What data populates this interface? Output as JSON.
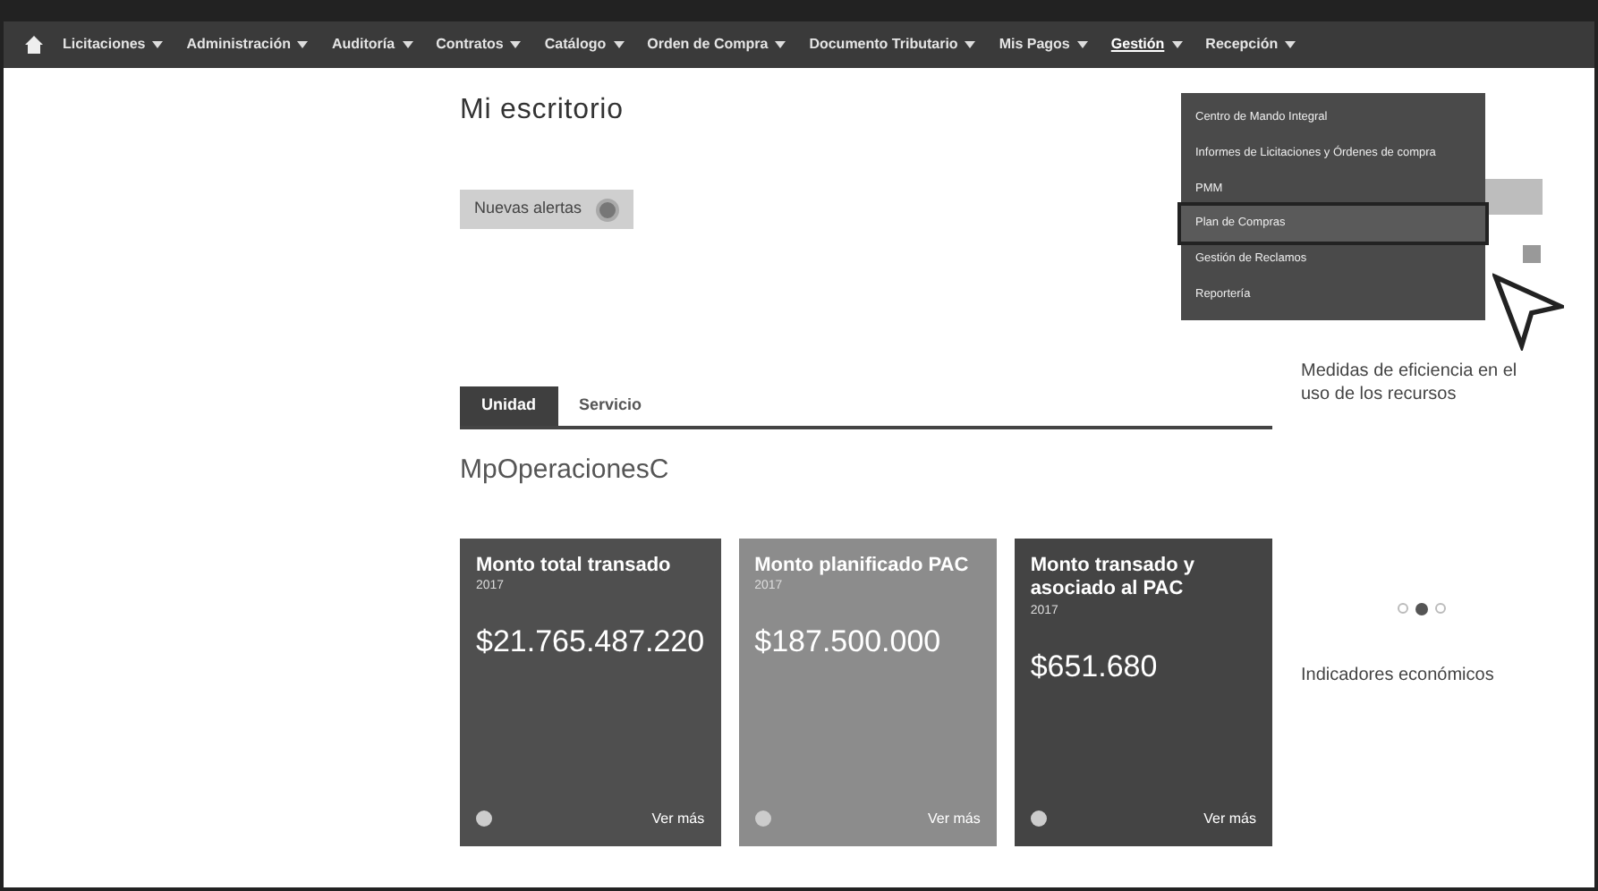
{
  "nav": {
    "items": [
      {
        "label": "Licitaciones",
        "open": false
      },
      {
        "label": "Administración",
        "open": false
      },
      {
        "label": "Auditoría",
        "open": false
      },
      {
        "label": "Contratos",
        "open": false
      },
      {
        "label": "Catálogo",
        "open": false
      },
      {
        "label": "Orden de Compra",
        "open": false
      },
      {
        "label": "Documento Tributario",
        "open": false
      },
      {
        "label": "Mis Pagos",
        "open": false
      },
      {
        "label": "Gestión",
        "open": true
      },
      {
        "label": "Recepción",
        "open": false
      }
    ]
  },
  "dropdown": {
    "items": [
      {
        "label": "Centro de Mando Integral",
        "selected": false
      },
      {
        "label": "Informes de Licitaciones y Órdenes de compra",
        "selected": false
      },
      {
        "label": "PMM",
        "selected": false
      },
      {
        "label": "Plan de Compras",
        "selected": true
      },
      {
        "label": "Gestión de Reclamos",
        "selected": false
      },
      {
        "label": "Reportería",
        "selected": false
      }
    ]
  },
  "page": {
    "title": "Mi escritorio",
    "alerts_button": "Nuevas alertas"
  },
  "tabs": [
    {
      "label": "Unidad",
      "selected": true
    },
    {
      "label": "Servicio",
      "selected": false
    }
  ],
  "unit": {
    "name": "MpOperacionesC"
  },
  "cards": [
    {
      "title": "Monto total transado",
      "year": "2017",
      "amount": "$21.765.487.220",
      "link": "Ver más",
      "color": "#4f4f4f"
    },
    {
      "title": "Monto planificado PAC",
      "year": "2017",
      "amount": "$187.500.000",
      "link": "Ver más",
      "color": "#8c8c8c"
    },
    {
      "title": "Monto transado y asociado al PAC",
      "year": "2017",
      "amount": "$651.680",
      "link": "Ver más",
      "color": "#444444"
    }
  ],
  "sidebar": {
    "efficiency_title": "Medidas de eficiencia en el uso de los recursos",
    "indicators_title": "Indicadores económicos"
  }
}
